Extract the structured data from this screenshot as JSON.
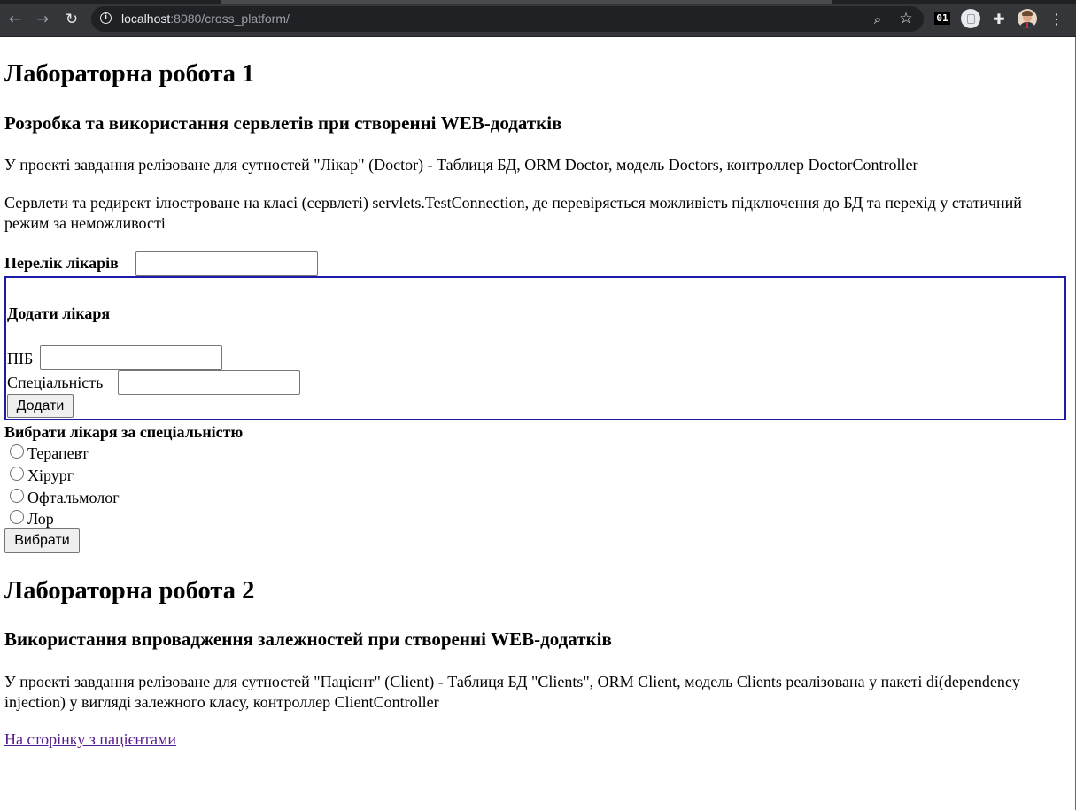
{
  "browser": {
    "url_host": "localhost",
    "url_rest": ":8080/cross_platform/",
    "extension_badge": "01"
  },
  "lab1": {
    "heading": "Лабораторна робота 1",
    "subheading": "Розробка та використання сервлетів при створенні WEB-додатків",
    "para1": "У проекті завдання релізоване для сутностей \"Лікар\" (Doctor) - Таблиця БД, ORM Doctor, модель Doctors, контроллер DoctorController",
    "para2": "Сервлети та редирект ілюстроване на класі (сервлеті) servlets.TestConnection, де перевіряється можливість підключення до БД та перехід у статичний режим за неможливості",
    "doctors_list_label": "Перелік лікарів",
    "doctors_list_value": "",
    "add_form": {
      "legend": "Додати лікаря",
      "name_label": "ПІБ",
      "name_value": "",
      "specialty_label": "Спеціальність",
      "specialty_value": "",
      "submit_label": "Додати"
    },
    "select_form": {
      "label": "Вибрати лікаря за спеціальністю",
      "options": [
        "Терапевт",
        "Хірург",
        "Офтальмолог",
        "Лор"
      ],
      "selected": null,
      "submit_label": "Вибрати"
    }
  },
  "lab2": {
    "heading": "Лабораторна робота 2",
    "subheading": "Використання впровадження залежностей при створенні WEB-додатків",
    "para": "У проекті завдання релізоване для сутностей \"Пацієнт\" (Client) - Таблиця БД \"Clients\", ORM Client, модель Clients реалізована у пакеті di(dependency injection) у вигляді залежного класу, контроллер ClientController",
    "link_text": "На сторінку з пацієнтами"
  }
}
